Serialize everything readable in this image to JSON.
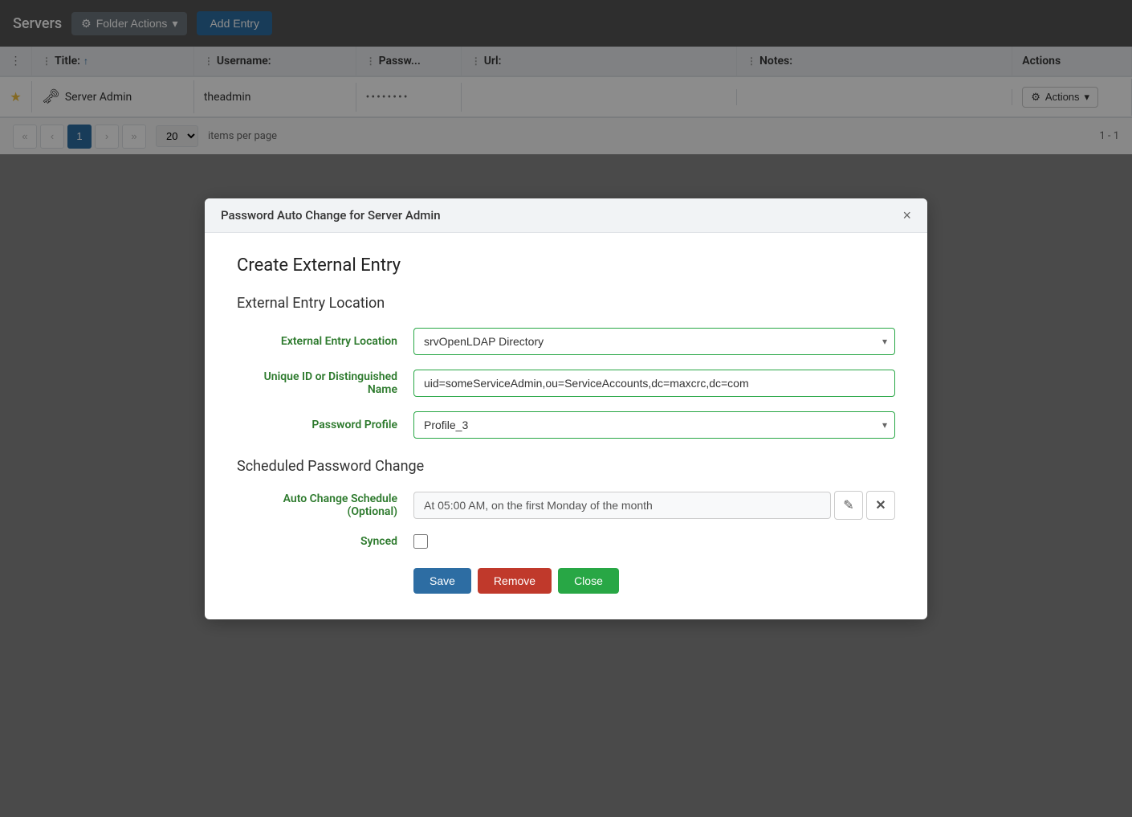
{
  "topbar": {
    "title": "Servers",
    "folder_actions_label": "Folder Actions",
    "add_entry_label": "Add Entry"
  },
  "table": {
    "columns": [
      {
        "label": "Title:",
        "sort": "asc"
      },
      {
        "label": "Username:"
      },
      {
        "label": "Passw..."
      },
      {
        "label": "Url:"
      },
      {
        "label": "Notes:"
      },
      {
        "label": "Actions"
      }
    ],
    "rows": [
      {
        "title": "Server Admin",
        "username": "theadmin",
        "password": "••••••••",
        "url": "",
        "notes": "",
        "actions_label": "Actions"
      }
    ],
    "pagination": {
      "current_page": 1,
      "per_page": 20,
      "items_label": "items per page",
      "range": "1 - 1"
    }
  },
  "modal": {
    "title": "Password Auto Change for Server Admin",
    "close_icon": "×",
    "section_title": "Create External Entry",
    "subsection_title": "External Entry Location",
    "fields": {
      "external_entry_location": {
        "label": "External Entry Location",
        "value": "srvOpenLDAP Directory",
        "options": [
          "srvOpenLDAP Directory"
        ]
      },
      "unique_id": {
        "label": "Unique ID or Distinguished Name",
        "value": "uid=someServiceAdmin,ou=ServiceAccounts,dc=maxcrc,dc=com"
      },
      "password_profile": {
        "label": "Password Profile",
        "value": "Profile_3",
        "options": [
          "Profile_3"
        ]
      }
    },
    "scheduled_section_title": "Scheduled Password Change",
    "schedule_field": {
      "label": "Auto Change Schedule (Optional)",
      "value": "At 05:00 AM, on the first Monday of the month"
    },
    "synced_label": "Synced",
    "buttons": {
      "save": "Save",
      "remove": "Remove",
      "close": "Close"
    }
  }
}
